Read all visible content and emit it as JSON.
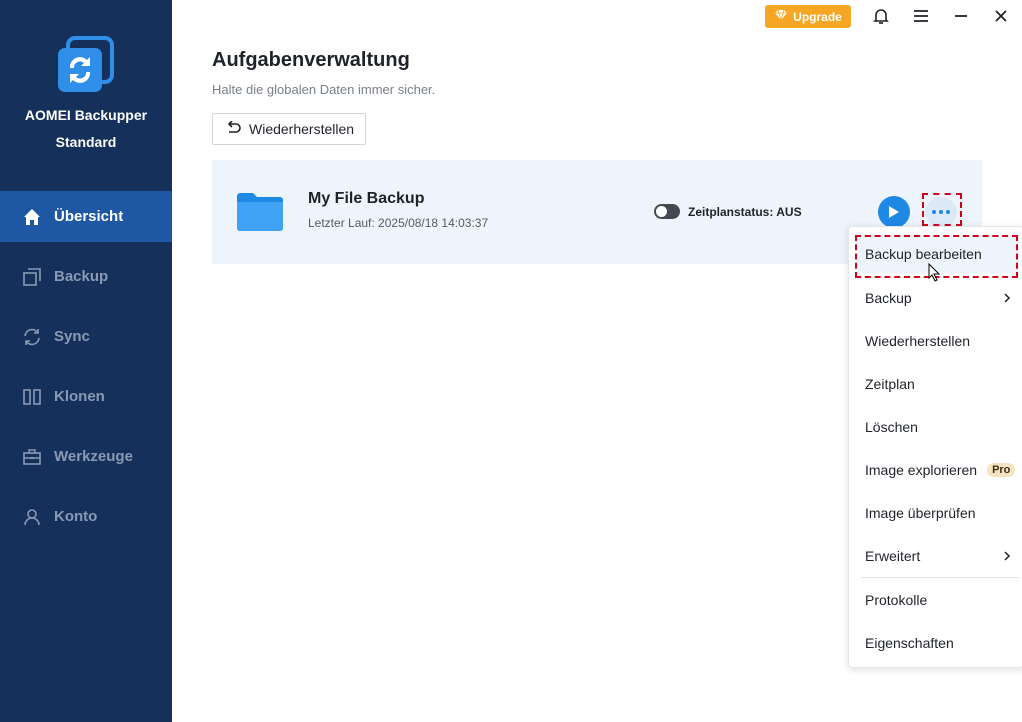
{
  "app": {
    "name_line1": "AOMEI Backupper",
    "name_line2": "Standard"
  },
  "titlebar": {
    "upgrade_label": "Upgrade",
    "accent_color": "#f5a623"
  },
  "sidebar": {
    "background": "#16305c",
    "active_color": "#1e57a3",
    "items": [
      {
        "label": "Übersicht",
        "icon": "home-icon",
        "active": true
      },
      {
        "label": "Backup",
        "icon": "backup-icon",
        "active": false
      },
      {
        "label": "Sync",
        "icon": "sync-icon",
        "active": false
      },
      {
        "label": "Klonen",
        "icon": "clone-icon",
        "active": false
      },
      {
        "label": "Werkzeuge",
        "icon": "toolbox-icon",
        "active": false
      },
      {
        "label": "Konto",
        "icon": "user-icon",
        "active": false
      }
    ]
  },
  "main": {
    "title": "Aufgabenverwaltung",
    "subtitle": "Halte die globalen Daten immer sicher.",
    "restore_button": "Wiederherstellen",
    "task": {
      "name": "My File Backup",
      "last_run": "Letzter Lauf: 2025/08/18 14:03:37",
      "schedule_status": "Zeitplanstatus: AUS",
      "schedule_enabled": false
    }
  },
  "menu": {
    "items": [
      {
        "label": "Backup bearbeiten",
        "has_submenu": false,
        "hovered": true
      },
      {
        "label": "Backup",
        "has_submenu": true
      },
      {
        "label": "Wiederherstellen",
        "has_submenu": false
      },
      {
        "label": "Zeitplan",
        "has_submenu": false
      },
      {
        "label": "Löschen",
        "has_submenu": false
      },
      {
        "label": "Image explorieren",
        "has_submenu": false,
        "badge": "Pro"
      },
      {
        "label": "Image überprüfen",
        "has_submenu": false
      },
      {
        "label": "Erweitert",
        "has_submenu": true
      },
      {
        "label": "Protokolle",
        "has_submenu": false
      },
      {
        "label": "Eigenschaften",
        "has_submenu": false
      }
    ]
  }
}
